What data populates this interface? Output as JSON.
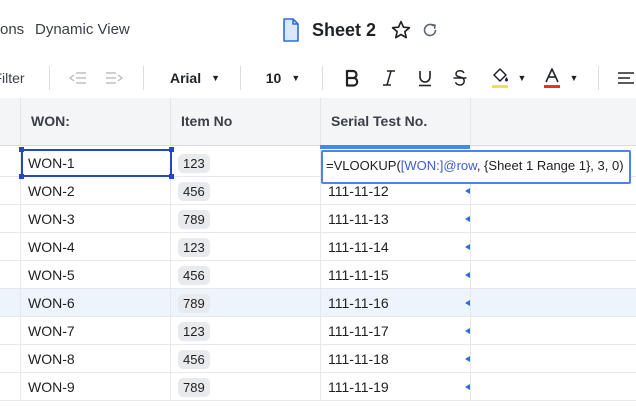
{
  "nav": {
    "truncated_item": "ons",
    "dynamic_view": "Dynamic View"
  },
  "sheet": {
    "title": "Sheet 2"
  },
  "toolbar": {
    "filter_label": "Filter",
    "font": "Arial",
    "font_size": "10"
  },
  "colors": {
    "accent_blue": "#4a86e8",
    "selection_blue": "#2645c8",
    "fill_underline": "#f2e14c",
    "text_color_underline": "#e0312b"
  },
  "columns": [
    "WON:",
    "Item No",
    "Serial Test No."
  ],
  "rows": [
    {
      "won": "WON-1",
      "item": "123",
      "serial": ""
    },
    {
      "won": "WON-2",
      "item": "456",
      "serial": "111-11-12"
    },
    {
      "won": "WON-3",
      "item": "789",
      "serial": "111-11-13"
    },
    {
      "won": "WON-4",
      "item": "123",
      "serial": "111-11-14"
    },
    {
      "won": "WON-5",
      "item": "456",
      "serial": "111-11-15"
    },
    {
      "won": "WON-6",
      "item": "789",
      "serial": "111-11-16"
    },
    {
      "won": "WON-7",
      "item": "123",
      "serial": "111-11-17"
    },
    {
      "won": "WON-8",
      "item": "456",
      "serial": "111-11-18"
    },
    {
      "won": "WON-9",
      "item": "789",
      "serial": "111-11-19"
    }
  ],
  "formula": {
    "prefix": "=VLOOKUP(",
    "ref": "[WON:]@row",
    "rest": ", {Sheet 1 Range 1}, 3, 0)"
  }
}
